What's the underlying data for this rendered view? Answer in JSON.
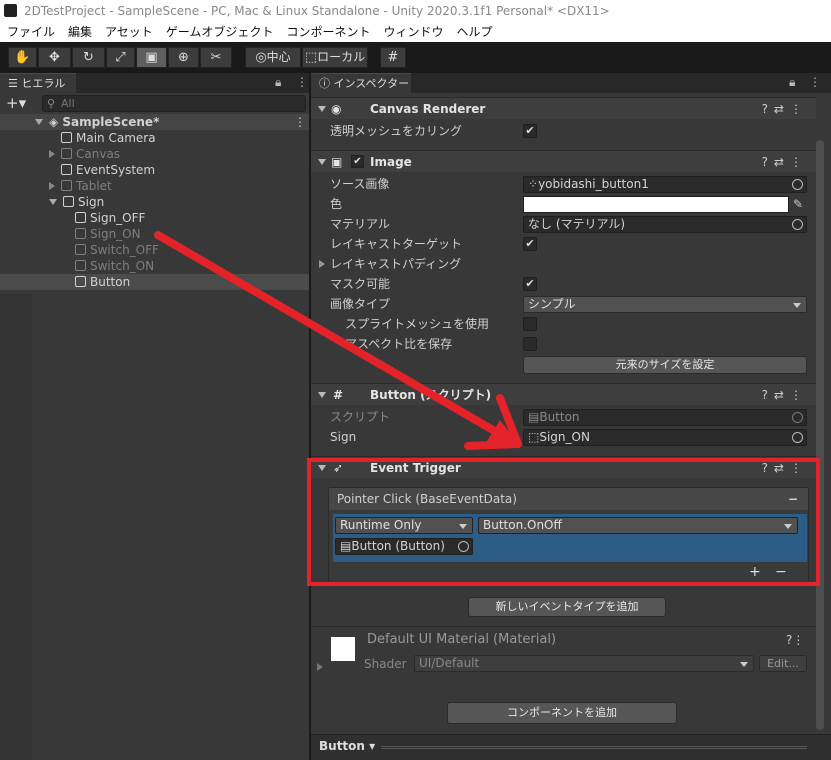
{
  "window": {
    "title": "2DTestProject - SampleScene - PC, Mac & Linux Standalone - Unity 2020.3.1f1 Personal* <DX11>"
  },
  "menu": [
    "ファイル",
    "編集",
    "アセット",
    "ゲームオブジェクト",
    "コンポーネント",
    "ウィンドウ",
    "ヘルプ"
  ],
  "toolbar": {
    "pivot_label": "中心",
    "space_label": "ローカル"
  },
  "hierarchy": {
    "tab_label": "ヒエラルキー",
    "search_placeholder": "All",
    "scene": "SampleScene*",
    "items": [
      {
        "label": "Main Camera"
      },
      {
        "label": "Canvas"
      },
      {
        "label": "EventSystem"
      },
      {
        "label": "Tablet"
      },
      {
        "label": "Sign"
      },
      {
        "label": "Sign_OFF"
      },
      {
        "label": "Sign_ON"
      },
      {
        "label": "Switch_OFF"
      },
      {
        "label": "Switch_ON"
      },
      {
        "label": "Button"
      }
    ]
  },
  "inspector": {
    "tab_label": "インスペクター",
    "canvas_renderer": {
      "title": "Canvas Renderer",
      "cull_label": "透明メッシュをカリング"
    },
    "image": {
      "title": "Image",
      "source_label": "ソース画像",
      "source_value": "yobidashi_button1",
      "color_label": "色",
      "material_label": "マテリアル",
      "material_value": "なし (マテリアル)",
      "raycast_label": "レイキャストターゲット",
      "padding_label": "レイキャストパディング",
      "maskable_label": "マスク可能",
      "type_label": "画像タイプ",
      "type_value": "シンプル",
      "sprite_mesh_label": "スプライトメッシュを使用",
      "aspect_label": "アスペクト比を保存",
      "native_size_button": "元来のサイズを設定"
    },
    "button_script": {
      "title": "Button (スクリプト)",
      "script_label": "スクリプト",
      "script_value": "Button",
      "sign_label": "Sign",
      "sign_value": "Sign_ON"
    },
    "event_trigger": {
      "title": "Event Trigger",
      "entry": "Pointer Click (BaseEventData)",
      "runtime": "Runtime Only",
      "function": "Button.OnOff",
      "target": "Button (Button)",
      "add_event_button": "新しいイベントタイプを追加"
    },
    "material": {
      "title": "Default UI Material (Material)",
      "shader_label": "Shader",
      "shader_value": "UI/Default",
      "edit_button": "Edit..."
    },
    "add_component_button": "コンポーネントを追加",
    "footer_label": "Button"
  },
  "colors": {
    "highlight_box": "#e3222a",
    "arrow": "#e3222a",
    "event_row": "#2c5d87"
  }
}
